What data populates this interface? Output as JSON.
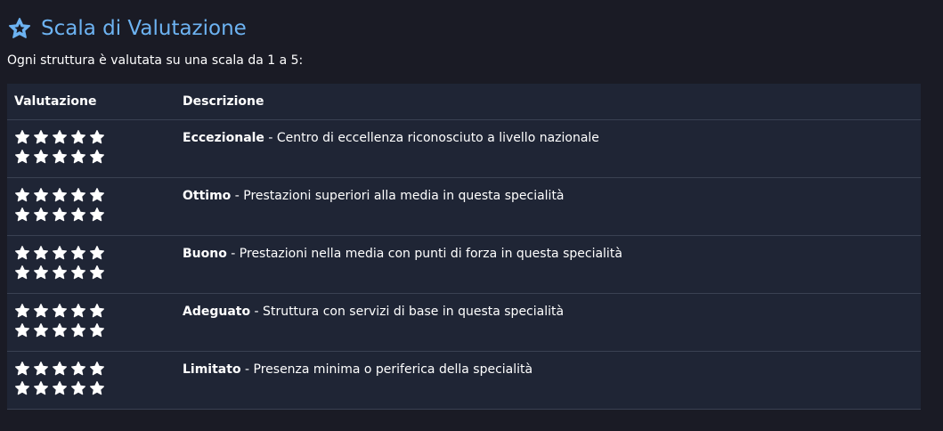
{
  "section": {
    "title": "Scala di Valutazione",
    "title_icon": "star-icon",
    "intro": "Ogni struttura è valutata su una scala da 1 a 5:"
  },
  "table": {
    "headers": [
      "Valutazione",
      "Descrizione"
    ],
    "rows": [
      {
        "stars": 10,
        "label": "Eccezionale",
        "text": " - Centro di eccellenza riconosciuto a livello nazionale"
      },
      {
        "stars": 10,
        "label": "Ottimo",
        "text": " - Prestazioni superiori alla media in questa specialità"
      },
      {
        "stars": 10,
        "label": "Buono",
        "text": " - Prestazioni nella media con punti di forza in questa specialità"
      },
      {
        "stars": 10,
        "label": "Adeguato",
        "text": " - Struttura con servizi di base in questa specialità"
      },
      {
        "stars": 10,
        "label": "Limitato",
        "text": " - Presenza minima o periferica della specialità"
      }
    ]
  },
  "colors": {
    "background": "#1a1b25",
    "table_background": "#1f2535",
    "accent": "#6db3f2",
    "text": "#ffffff",
    "divider": "#3a4152"
  }
}
